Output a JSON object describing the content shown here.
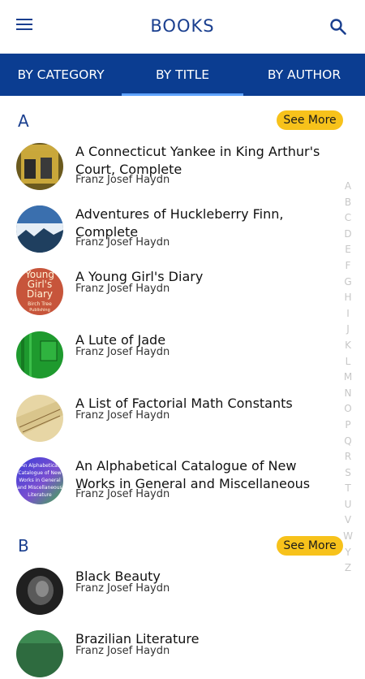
{
  "header": {
    "title": "BOOKS",
    "menu_icon": "hamburger-menu-icon",
    "search_icon": "search-icon"
  },
  "tabs": [
    {
      "label": "BY CATEGORY",
      "active": false
    },
    {
      "label": "BY TITLE",
      "active": true
    },
    {
      "label": "BY AUTHOR",
      "active": false
    }
  ],
  "sections": [
    {
      "letter": "A",
      "see_more": "See More",
      "books": [
        {
          "title": "A Connecticut Yankee in King Arthur's Court, Complete",
          "author": "Franz Josef Haydn"
        },
        {
          "title": "Adventures of Huckleberry Finn, Complete",
          "author": "Franz Josef Haydn"
        },
        {
          "title": "A Young Girl's Diary",
          "author": "Franz Josef Haydn",
          "cover_text": [
            "Young",
            "Girl's",
            "Diary",
            "Birch Tree",
            "Publishing"
          ]
        },
        {
          "title": "A Lute of Jade",
          "author": "Franz Josef Haydn"
        },
        {
          "title": "A List of Factorial Math Constants",
          "author": "Franz Josef Haydn"
        },
        {
          "title": "An Alphabetical Catalogue of New Works in General and Miscellaneous",
          "author": "Franz Josef Haydn",
          "cover_text": [
            "An Alphabetical",
            "Catalogue of New",
            "Works in General",
            "and Miscellaneous",
            "Literature"
          ]
        }
      ]
    },
    {
      "letter": "B",
      "see_more": "See More",
      "books": [
        {
          "title": "Black Beauty",
          "author": "Franz Josef Haydn"
        },
        {
          "title": "Brazilian Literature",
          "author": "Franz Josef Haydn"
        }
      ]
    }
  ],
  "index_letters": [
    "A",
    "B",
    "C",
    "D",
    "E",
    "F",
    "G",
    "H",
    "I",
    "J",
    "K",
    "L",
    "M",
    "N",
    "O",
    "P",
    "Q",
    "R",
    "S",
    "T",
    "U",
    "V",
    "W",
    "Y",
    "Z"
  ],
  "colors": {
    "primary": "#0b3d91",
    "tab_indicator": "#5ea3ff",
    "see_more_bg": "#f7c21b",
    "header_text": "#1a3f8f"
  }
}
